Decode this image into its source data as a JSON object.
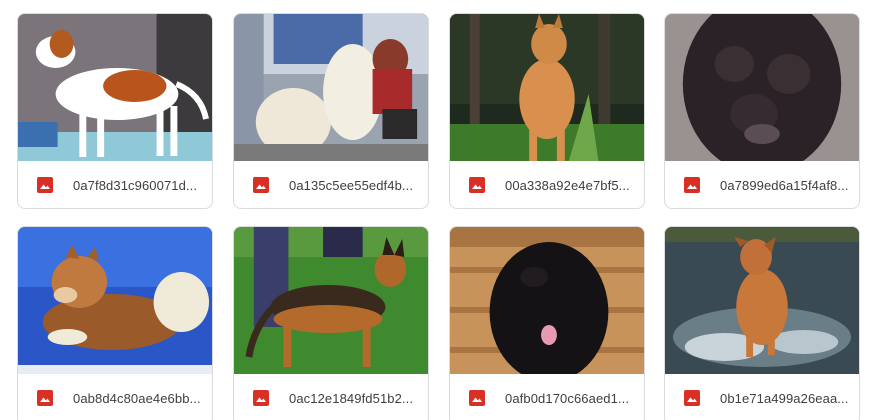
{
  "files": [
    {
      "name": "0a7f8d31c960071d...",
      "thumbnail": "dog-photo"
    },
    {
      "name": "0a135c5ee55edf4b...",
      "thumbnail": "dog-photo"
    },
    {
      "name": "00a338a92e4e7bf5...",
      "thumbnail": "dog-photo"
    },
    {
      "name": "0a7899ed6a15f4af8...",
      "thumbnail": "dog-photo"
    },
    {
      "name": "0ab8d4c80ae4e6bb...",
      "thumbnail": "dog-photo"
    },
    {
      "name": "0ac12e1849fd51b2...",
      "thumbnail": "dog-photo"
    },
    {
      "name": "0afb0d170c66aed1...",
      "thumbnail": "dog-photo"
    },
    {
      "name": "0b1e71a499a26eaa...",
      "thumbnail": "dog-photo"
    }
  ],
  "file_type_icon": "image-file-icon",
  "colors": {
    "file_icon": "#d93025",
    "card_border": "#dadce0",
    "text": "#3c4043"
  }
}
